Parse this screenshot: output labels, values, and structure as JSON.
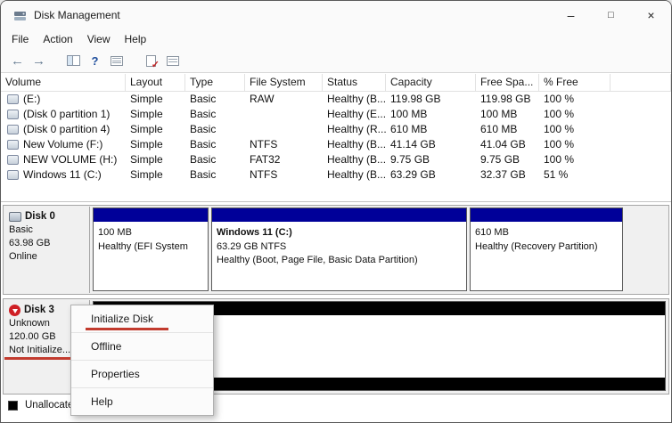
{
  "window": {
    "title": "Disk Management",
    "controls": {
      "minimize": "–",
      "maximize": "□",
      "close": "×"
    }
  },
  "menu": {
    "items": [
      "File",
      "Action",
      "View",
      "Help"
    ]
  },
  "toolbar": {
    "back_glyph": "←",
    "forward_glyph": "→",
    "help_glyph": "?",
    "check_glyph": "✓",
    "icon_names": [
      "back-arrow",
      "forward-arrow",
      "console-tree",
      "help",
      "export-list",
      "doc-check",
      "list-panel"
    ]
  },
  "volume_list": {
    "columns": [
      "Volume",
      "Layout",
      "Type",
      "File System",
      "Status",
      "Capacity",
      "Free Spa...",
      "% Free"
    ],
    "rows": [
      {
        "volume": "(E:)",
        "layout": "Simple",
        "type": "Basic",
        "file_system": "RAW",
        "status": "Healthy (B...",
        "capacity": "119.98 GB",
        "free_space": "119.98 GB",
        "pct_free": "100 %"
      },
      {
        "volume": "(Disk 0 partition 1)",
        "layout": "Simple",
        "type": "Basic",
        "file_system": "",
        "status": "Healthy (E...",
        "capacity": "100 MB",
        "free_space": "100 MB",
        "pct_free": "100 %"
      },
      {
        "volume": "(Disk 0 partition 4)",
        "layout": "Simple",
        "type": "Basic",
        "file_system": "",
        "status": "Healthy (R...",
        "capacity": "610 MB",
        "free_space": "610 MB",
        "pct_free": "100 %"
      },
      {
        "volume": "New Volume (F:)",
        "layout": "Simple",
        "type": "Basic",
        "file_system": "NTFS",
        "status": "Healthy (B...",
        "capacity": "41.14 GB",
        "free_space": "41.04 GB",
        "pct_free": "100 %"
      },
      {
        "volume": "NEW VOLUME (H:)",
        "layout": "Simple",
        "type": "Basic",
        "file_system": "FAT32",
        "status": "Healthy (B...",
        "capacity": "9.75 GB",
        "free_space": "9.75 GB",
        "pct_free": "100 %"
      },
      {
        "volume": "Windows 11 (C:)",
        "layout": "Simple",
        "type": "Basic",
        "file_system": "NTFS",
        "status": "Healthy (B...",
        "capacity": "63.29 GB",
        "free_space": "32.37 GB",
        "pct_free": "51 %"
      }
    ]
  },
  "disks": [
    {
      "name": "Disk 0",
      "kind": "Basic",
      "size": "63.98 GB",
      "status": "Online",
      "partitions": [
        {
          "line1": "100 MB",
          "line2": "Healthy (EFI System",
          "line3": ""
        },
        {
          "line1": "Windows 11  (C:)",
          "line2": "63.29 GB NTFS",
          "line3": "Healthy (Boot, Page File, Basic Data Partition)"
        },
        {
          "line1": "610 MB",
          "line2": "Healthy (Recovery Partition)",
          "line3": ""
        }
      ]
    },
    {
      "name": "Disk 3",
      "kind": "Unknown",
      "size": "120.00 GB",
      "status": "Not Initialize..."
    }
  ],
  "context_menu": {
    "items": [
      "Initialize Disk",
      "Offline",
      "Properties",
      "Help"
    ]
  },
  "legend": {
    "unallocated": "Unallocate..."
  },
  "colors": {
    "partition_strip": "#000099",
    "unallocated_strip": "#000000",
    "annotation_red": "#c23b2e"
  }
}
